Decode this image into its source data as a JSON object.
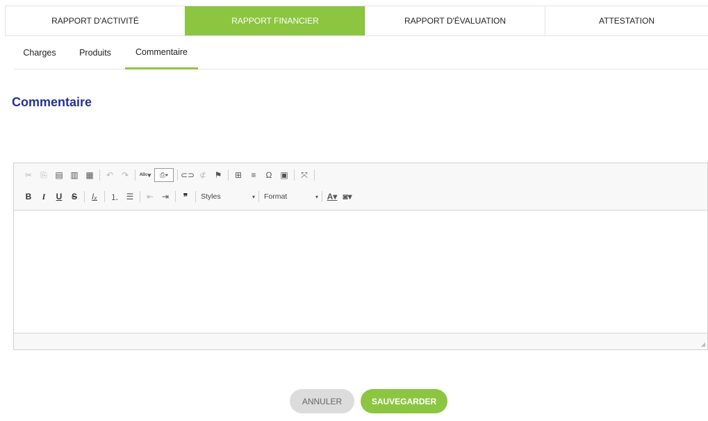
{
  "top_tabs": [
    {
      "label": "RAPPORT D'ACTIVITÉ",
      "active": false
    },
    {
      "label": "RAPPORT FINANCIER",
      "active": true
    },
    {
      "label": "RAPPORT D'ÉVALUATION",
      "active": false
    },
    {
      "label": "ATTESTATION",
      "active": false
    }
  ],
  "sub_tabs": [
    {
      "label": "Charges",
      "active": false
    },
    {
      "label": "Produits",
      "active": false
    },
    {
      "label": "Commentaire",
      "active": true
    }
  ],
  "section_title": "Commentaire",
  "editor": {
    "toolbar_row1": [
      "cut-icon",
      "copy-icon",
      "paste-icon",
      "paste-text-icon",
      "paste-word-icon",
      "undo-icon",
      "redo-icon",
      "spellcheck-icon",
      "scayt-icon",
      "link-icon",
      "unlink-icon",
      "anchor-icon",
      "table-icon",
      "horizontal-rule-icon",
      "special-char-icon",
      "image-icon",
      "maximize-icon"
    ],
    "toolbar_row2": [
      "bold-icon",
      "italic-icon",
      "underline-icon",
      "strike-icon",
      "remove-format-icon",
      "numbered-list-icon",
      "bulleted-list-icon",
      "outdent-icon",
      "indent-icon",
      "blockquote-icon",
      "text-color-icon",
      "bg-color-icon"
    ],
    "styles_label": "Styles",
    "format_label": "Format",
    "content": ""
  },
  "buttons": {
    "cancel": "ANNULER",
    "save": "SAUVEGARDER"
  },
  "colors": {
    "accent": "#8cc540",
    "title": "#26318f",
    "cancel_bg": "#dcdcdc"
  }
}
